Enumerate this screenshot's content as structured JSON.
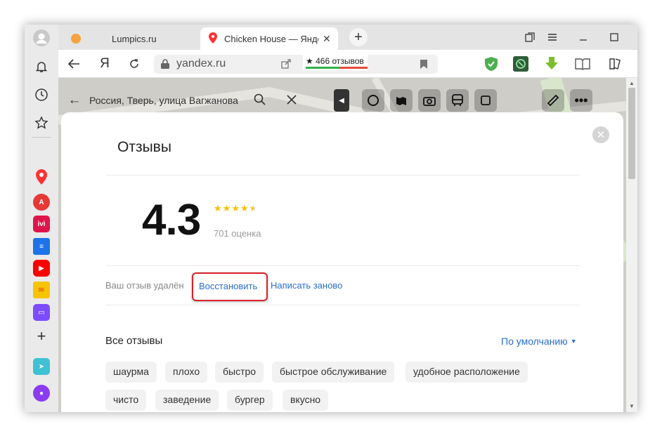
{
  "browser": {
    "tabs": [
      {
        "label": "Lumpics.ru",
        "active": false
      },
      {
        "label": "Chicken House — Яндекс",
        "active": true
      }
    ],
    "new_tab_label": "+",
    "address": {
      "url": "yandex.ru"
    },
    "reviews_badge": "★ 466 отзывов",
    "yandex_button": "Я"
  },
  "map": {
    "search_query": "Россия, Тверь, улица Вагжанова"
  },
  "reviews": {
    "title": "Отзывы",
    "rating": "4.3",
    "stars_full": 4,
    "stars_half": 1,
    "rating_count": "701 оценка",
    "deleted_message": "Ваш отзыв удалён",
    "restore_label": "Восстановить",
    "rewrite_label": "Написать заново",
    "all_reviews_label": "Все отзывы",
    "sort_label": "По умолчанию",
    "tags": [
      "шаурма",
      "плохо",
      "быстро",
      "быстрое обслуживание",
      "удобное расположение",
      "чисто",
      "заведение",
      "бургер",
      "вкусно"
    ]
  },
  "colors": {
    "accent_link": "#2a6ed1",
    "star": "#f6c000",
    "highlight": "#d9202a"
  }
}
